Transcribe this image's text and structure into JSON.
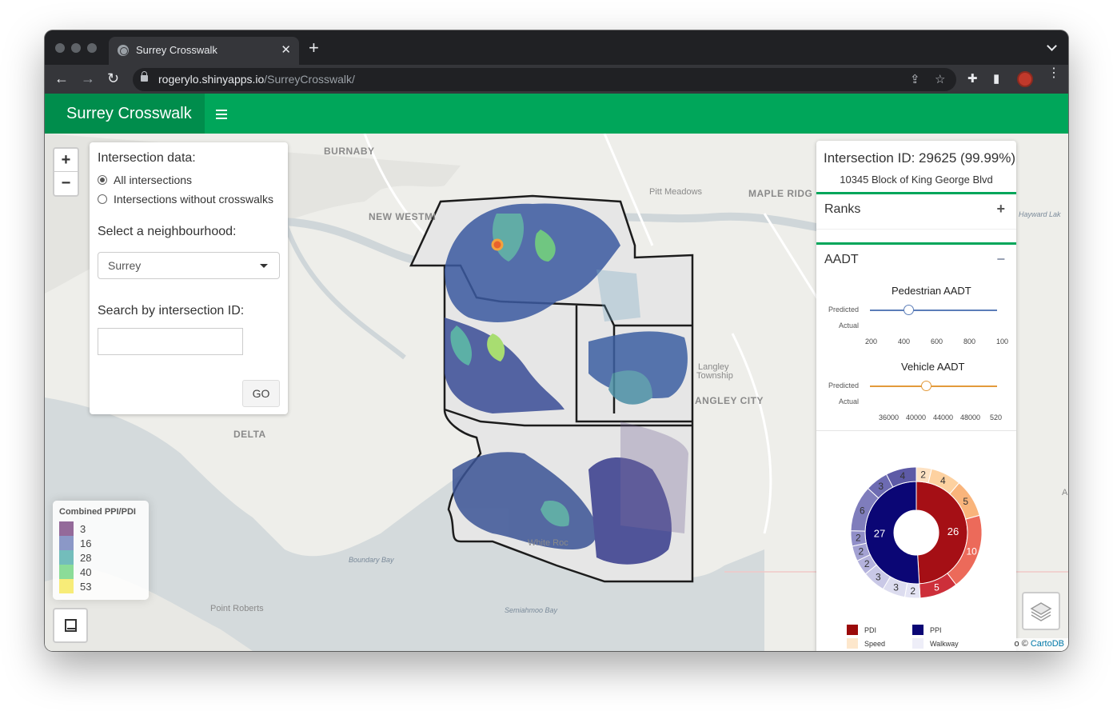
{
  "browser": {
    "tab_title": "Surrey Crosswalk",
    "url_host": "rogerylo.shinyapps.io",
    "url_path": "/SurreyCrosswalk/"
  },
  "app": {
    "brand": "Surrey Crosswalk"
  },
  "controls": {
    "intersection_heading": "Intersection data:",
    "radio_all": "All intersections",
    "radio_without": "Intersections without crosswalks",
    "selected_radio": "All intersections",
    "neighbourhood_heading": "Select a neighbourhood:",
    "neighbourhood_value": "Surrey",
    "search_heading": "Search by intersection ID:",
    "search_value": "",
    "go_label": "GO"
  },
  "map_labels": {
    "burnaby": "BURNABY",
    "new_westminster": "NEW WESTMI",
    "pitt_meadows": "Pitt Meadows",
    "maple_ridge": "MAPLE RIDG",
    "hayward": "Hayward Lak",
    "langley_township_1": "Langley",
    "langley_township_2": "Township",
    "langley_city": "ANGLEY CITY",
    "delta": "DELTA",
    "white_rock": "White Roc",
    "boundary_bay": "Boundary Bay",
    "point_roberts": "Point Roberts",
    "semiahmoo_bay": "Semiahmoo Bay",
    "edge_a": "A"
  },
  "legend": {
    "title": "Combined PPI/PDI",
    "items": [
      {
        "label": "3",
        "color": "#6a2c70"
      },
      {
        "label": "16",
        "color": "#5d6db0"
      },
      {
        "label": "28",
        "color": "#3ba3a0"
      },
      {
        "label": "40",
        "color": "#5ccf6e"
      },
      {
        "label": "53",
        "color": "#f5e640"
      }
    ]
  },
  "info": {
    "title": "Intersection ID: 29625 (99.99%)",
    "address": "10345 Block of King George Blvd",
    "ranks_label": "Ranks",
    "aadt_label": "AADT",
    "pedestrian": {
      "title": "Pedestrian AADT",
      "predicted_label": "Predicted",
      "actual_label": "Actual",
      "ticks": [
        "200",
        "400",
        "600",
        "800",
        "100"
      ],
      "color": "#5b7db8"
    },
    "vehicle": {
      "title": "Vehicle AADT",
      "predicted_label": "Predicted",
      "actual_label": "Actual",
      "ticks": [
        "36000",
        "40000",
        "44000",
        "48000",
        "520"
      ],
      "color": "#e39a3b"
    }
  },
  "chart_data": {
    "type": "pie",
    "inner": [
      {
        "label": "26",
        "value": 26,
        "color": "#a50f15",
        "name": "PDI"
      },
      {
        "label": "27",
        "value": 27,
        "color": "#0b0675",
        "name": "PPI"
      }
    ],
    "outer": [
      {
        "label": "2",
        "value": 2,
        "color": "#fde2c3"
      },
      {
        "label": "4",
        "value": 4,
        "color": "#fdd1a0"
      },
      {
        "label": "5",
        "value": 5,
        "color": "#f9b47b"
      },
      {
        "label": "10",
        "value": 10,
        "color": "#ec6a5a"
      },
      {
        "label": "5",
        "value": 5,
        "color": "#cd2f3a"
      },
      {
        "label": "2",
        "value": 2,
        "color": "#e4e4f4"
      },
      {
        "label": "3",
        "value": 3,
        "color": "#dcdcef"
      },
      {
        "label": "3",
        "value": 3,
        "color": "#c9c8e6"
      },
      {
        "label": "2",
        "value": 2,
        "color": "#b4b2dc"
      },
      {
        "label": "2",
        "value": 2,
        "color": "#a3a1d2"
      },
      {
        "label": "2",
        "value": 2,
        "color": "#908ec8"
      },
      {
        "label": "6",
        "value": 6,
        "color": "#7f7dbc"
      },
      {
        "label": "3",
        "value": 3,
        "color": "#6d6bb2"
      },
      {
        "label": "4",
        "value": 4,
        "color": "#5d5aa6"
      }
    ],
    "legend": [
      {
        "label": "PDI",
        "color": "#9b0a0a"
      },
      {
        "label": "PPI",
        "color": "#0b0675"
      },
      {
        "label": "Speed",
        "color": "#fde7cc"
      },
      {
        "label": "Walkway",
        "color": "#eeeef8"
      }
    ]
  },
  "attribution": {
    "sep": "o ©",
    "link": "CartoDB"
  }
}
